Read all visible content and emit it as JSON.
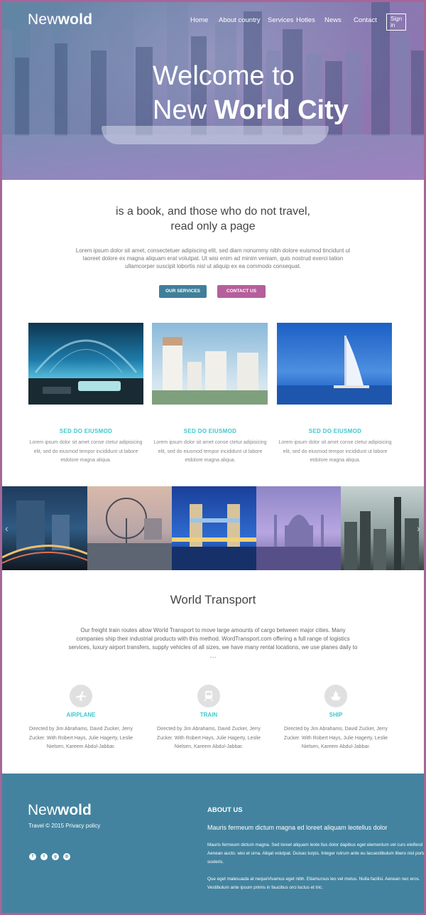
{
  "brand": {
    "name_light": "New",
    "name_bold": "wold"
  },
  "nav": {
    "items": [
      "Home",
      "About country",
      "Services",
      "Hotles",
      "News",
      "Contact"
    ],
    "signin": "Sign in"
  },
  "hero": {
    "line1": "Welcome to",
    "line2_light": "New ",
    "line2_bold": "World City"
  },
  "intro": {
    "heading_line1": "is a book, and those who do not travel,",
    "heading_line2": "read only a page",
    "text": "Lorem ipsum dolor sit amet, consectetuer adipiscing elit, sed diam nonummy nibh dolore euismod tincidunt ut laoreet dolore ex magna aliquam erat volutpat. Ut wisi enim ad minim veniam, quis nostrud exerci tation ullamcorper suscipit lobortis nisl ut aliquip ex ea commodo consequat.",
    "button_services": "OUR SERVICES",
    "button_contact": "CONTACT US"
  },
  "features": [
    {
      "title": "SED DO EIUSMOD",
      "text": "Lorem ipsum dolor sit amet conse ctetur adipisicing elit, sed do eiusmod tempor incididunt ut labore etdolore magna aliqua."
    },
    {
      "title": "SED DO EIUSMOD",
      "text": "Lorem ipsum dolor sit amet conse ctetur adipisicing elit, sed do eiusmod tempor incididunt ut labore etdolore magna aliqua."
    },
    {
      "title": "SED DO EIUSMOD",
      "text": "Lorem ipsum dolor sit amet conse ctetur adipisicing elit, sed do eiusmod tempor incididunt ut labore etdolore magna aliqua."
    }
  ],
  "transport": {
    "title": "World Transport",
    "text": "Our freight train routes allow World Transport to move large amounts of cargo between major cities. Many companies ship their industrial products with this method. WordTransport.com offering a full range of logistics services, luxury airport transfers, supply vehicles of all sizes, we have many rental locations, we use planes daily to ....",
    "items": [
      {
        "title": "AIRPLANE",
        "icon": "airplane-icon",
        "text": "Directed by Jim Abrahams, David Zucker, Jerry Zucker. With Robert Hays, Julie Hagerty, Leslie Nielsen, Kareem Abdul-Jabbar."
      },
      {
        "title": "TRAIN",
        "icon": "train-icon",
        "text": "Directed by Jim Abrahams, David Zucker, Jerry Zucker. With Robert Hays, Julie Hagerty, Leslie Nielsen, Kareem Abdul-Jabbar."
      },
      {
        "title": "SHIP",
        "icon": "ship-icon",
        "text": "Directed by Jim Abrahams, David Zucker, Jerry Zucker. With Robert Hays, Julie Hagerty, Leslie Nielsen, Kareem Abdul-Jabbar."
      }
    ]
  },
  "footer": {
    "copyright": "Travel © 2015 Privacy policy",
    "social": [
      "facebook-icon",
      "twitter-icon",
      "google-plus-icon",
      "instagram-icon"
    ],
    "about_title": "ABOUT US",
    "about_subtitle": "Mauris fermeum dictum magna ed loreet aliquam leotellus dolor",
    "about_p1": "Mauris fermeum dictum magna. Sed loreet aliquam leote llus dolor dapibus eget elementum vel curs eleifend elit. Aenean aucto. wisi et urna. Aliqat volutpat. Duisac turpis. Integer rutrum ante eu lacuestibulum libero nisl porta vel sceleris.",
    "about_p2": "Que eget malesuada at nequeVivamus eget nibh. Etiamursus leo vel metus. Nulla facilisi. Aenean nec eros. Vestibulum ante ipsum primis in faucibus orci luctus et tric."
  },
  "colors": {
    "accent_teal": "#3ec7cc",
    "button_blue": "#3f7f9a",
    "button_pink": "#b55f9b",
    "footer_bg": "#43839f",
    "frame_border": "#a6669a"
  }
}
